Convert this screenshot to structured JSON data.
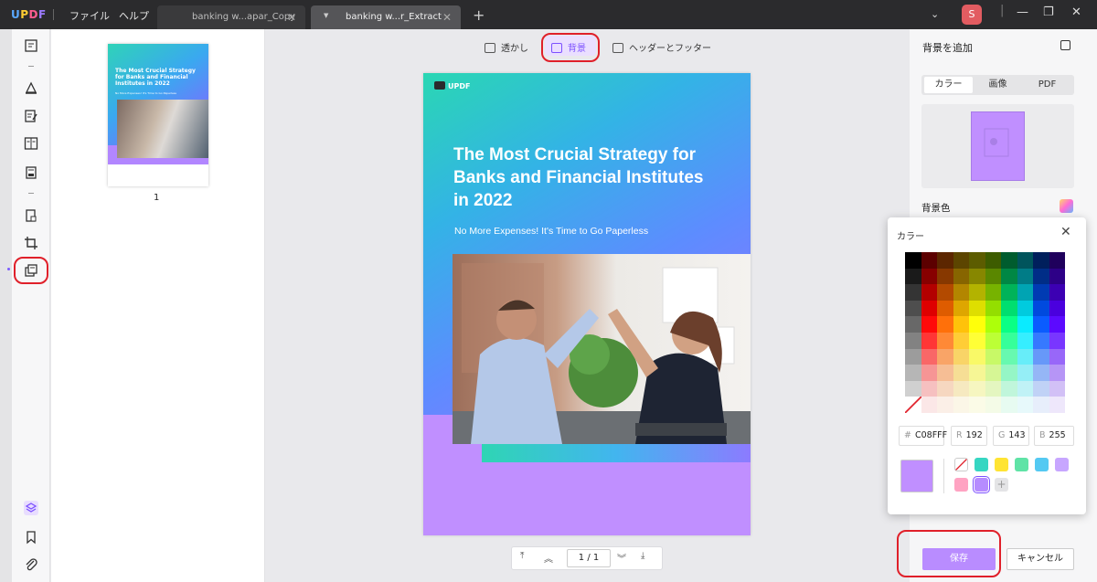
{
  "app": {
    "logo": "UPDF",
    "menu": [
      "ファイル",
      "ヘルプ"
    ],
    "avatar_initial": "S"
  },
  "tabs": [
    {
      "label": "banking w...apar_Copy",
      "active": false
    },
    {
      "label": "banking w...r_Extract",
      "active": true
    }
  ],
  "toolbar": {
    "watermark": "透かし",
    "background": "背景",
    "header_footer": "ヘッダーとフッター"
  },
  "thumbnail": {
    "page_number": "1",
    "title": "The Most Crucial Strategy for Banks and Financial Institutes in 2022",
    "subtitle": "No More Expenses! It's Time to Go Paperless"
  },
  "document": {
    "logo_text": "UPDF",
    "title": "The Most Crucial Strategy for Banks and Financial Institutes in 2022",
    "subtitle": "No More Expenses! It's Time to Go Paperless"
  },
  "pager": {
    "current": "1",
    "separator": "/",
    "total": "1"
  },
  "right_panel": {
    "title": "背景を追加",
    "tabs": [
      "カラー",
      "画像",
      "PDF"
    ],
    "bg_color_label": "背景色"
  },
  "color_picker": {
    "title": "カラー",
    "hex_label": "#",
    "hex": "C08FFF",
    "r_label": "R",
    "r": "192",
    "g_label": "G",
    "g": "143",
    "b_label": "B",
    "b": "255",
    "current_color": "#C08FFF",
    "presets": [
      "none",
      "#36D6C2",
      "#FFE433",
      "#5FE3A6",
      "#54C9F2",
      "#C7A6FF",
      "#FFA3C2",
      "#B68CFF",
      "add"
    ]
  },
  "actions": {
    "save": "保存",
    "cancel": "キャンセル"
  },
  "colors": {
    "accent": "#7C50FF",
    "page_bg": "#C08FFF",
    "highlight": "#E0202A"
  }
}
